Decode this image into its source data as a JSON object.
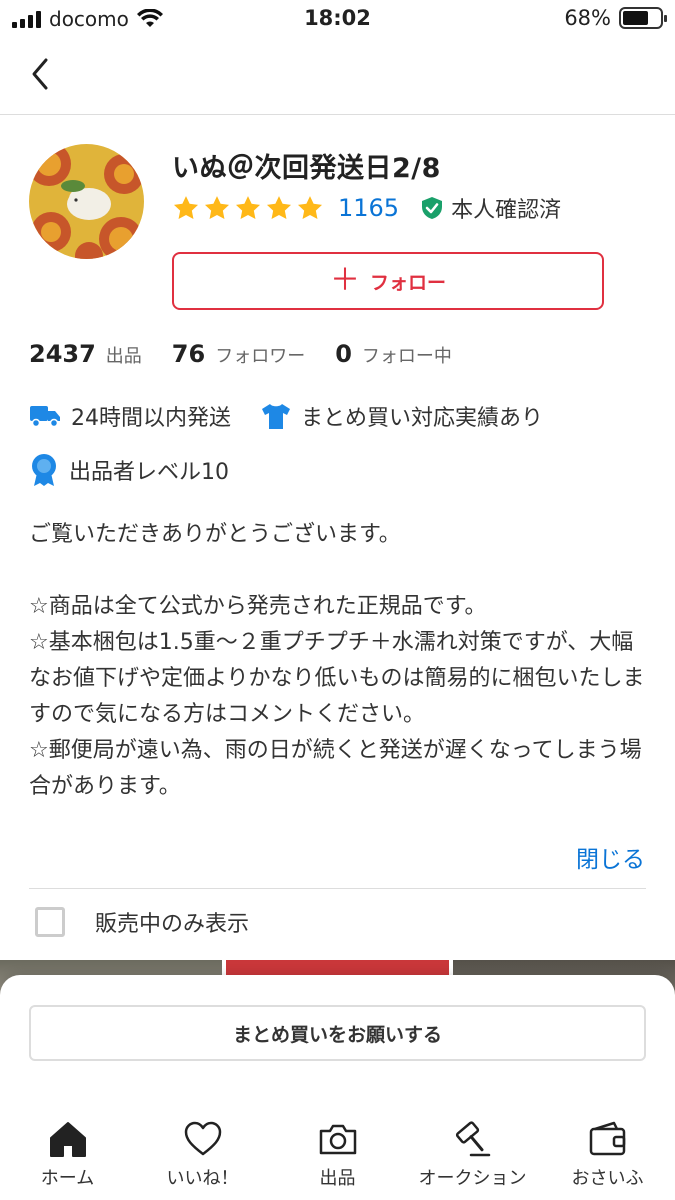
{
  "status_bar": {
    "carrier": "docomo",
    "time": "18:02",
    "battery": "68%"
  },
  "profile": {
    "name": "いぬ＠次回発送日2/8",
    "rating_stars": 5,
    "review_count": "1165",
    "verified_label": "本人確認済",
    "follow_label": "フォロー"
  },
  "stats": [
    {
      "num": "2437",
      "label": "出品"
    },
    {
      "num": "76",
      "label": "フォロワー"
    },
    {
      "num": "0",
      "label": "フォロー中"
    }
  ],
  "badges": {
    "shipping": "24時間以内発送",
    "bundle": "まとめ買い対応実績あり",
    "level": "出品者レベル10"
  },
  "intro": "ご覧いただきありがとうございます。\n\n☆商品は全て公式から発売された正規品です。\n☆基本梱包は1.5重〜２重プチプチ＋水濡れ対策ですが、大幅なお値下げや定価よりかなり低いものは簡易的に梱包いたしますので気になる方はコメントください。\n☆郵便局が遠い為、雨の日が続くと発送が遅くなってしまう場合があります。",
  "close_label": "閉じる",
  "filter_label": "販売中のみ表示",
  "bundle_request_label": "まとめ買いをお願いする",
  "tabs": [
    {
      "label": "ホーム",
      "icon": "home-icon"
    },
    {
      "label": "いいね！",
      "icon": "heart-icon"
    },
    {
      "label": "出品",
      "icon": "camera-icon"
    },
    {
      "label": "オークション",
      "icon": "gavel-icon"
    },
    {
      "label": "おさいふ",
      "icon": "wallet-icon"
    }
  ],
  "colors": {
    "accent_red": "#e03040",
    "link_blue": "#0a74d6",
    "star_yellow": "#ffb818",
    "verified_green": "#1aa06a",
    "badge_blue": "#1e88e5"
  }
}
